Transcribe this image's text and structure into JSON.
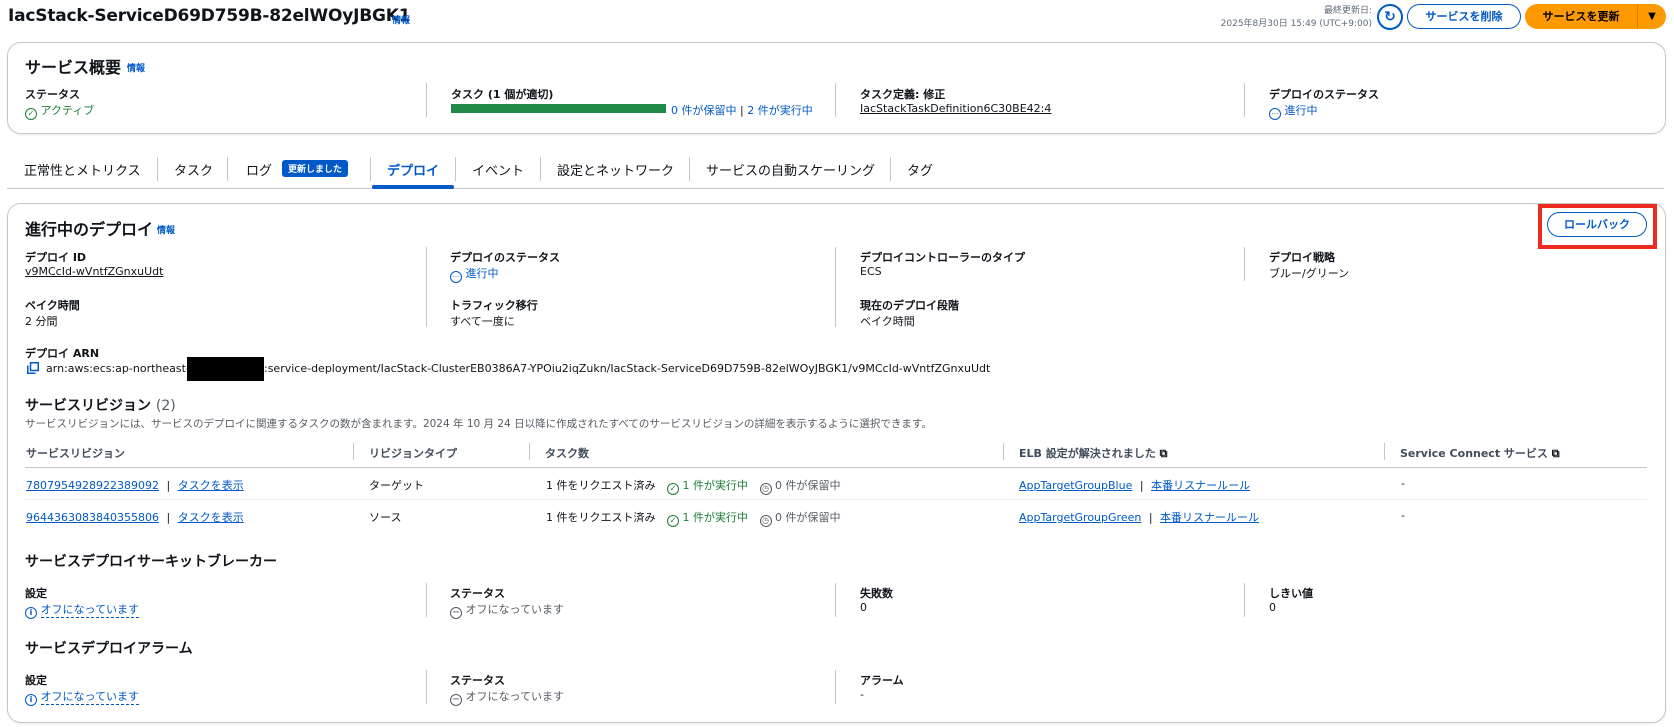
{
  "header": {
    "title": "IacStack-ServiceD69D759B-82elWOyJBGK1",
    "info": "情報",
    "last_updated_label": "最終更新日:",
    "last_updated_value": "2025年8月30日 15:49 (UTC+9:00)",
    "delete_label": "サービスを削除",
    "update_label": "サービスを更新"
  },
  "overview": {
    "heading": "サービス概要",
    "info": "情報",
    "status_label": "ステータス",
    "status_value": "アクティブ",
    "tasks_label": "タスク (1 個が適切)",
    "tasks_progress": 1.0,
    "tasks_pending": "0 件が保留中",
    "tasks_sep": "|",
    "tasks_running": "2 件が実行中",
    "taskdef_label": "タスク定義: 修正",
    "taskdef_value": "IacStackTaskDefinition6C30BE42:4",
    "deploy_status_label": "デプロイのステータス",
    "deploy_status_value": "進行中"
  },
  "tabs": [
    {
      "label": "正常性とメトリクス"
    },
    {
      "label": "タスク"
    },
    {
      "label": "ログ",
      "badge": "更新しました"
    },
    {
      "label": "デプロイ",
      "active": true
    },
    {
      "label": "イベント"
    },
    {
      "label": "設定とネットワーク"
    },
    {
      "label": "サービスの自動スケーリング"
    },
    {
      "label": "タグ"
    }
  ],
  "deployment": {
    "heading": "進行中のデプロイ",
    "info": "情報",
    "rollback_label": "ロールバック",
    "id_label": "デプロイ ID",
    "id_value": "v9MCcId-wVntfZGnxuUdt",
    "status_label": "デプロイのステータス",
    "status_value": "進行中",
    "controller_label": "デプロイコントローラーのタイプ",
    "controller_value": "ECS",
    "strategy_label": "デプロイ戦略",
    "strategy_value": "ブルー/グリーン",
    "bake_label": "ベイク時間",
    "bake_value": "2 分間",
    "traffic_label": "トラフィック移行",
    "traffic_value": "すべて一度に",
    "phase_label": "現在のデプロイ段階",
    "phase_value": "ベイク時間",
    "arn_label": "デプロイ ARN",
    "arn_prefix": "arn:aws:ecs:ap-northeast-1:",
    "arn_suffix": ":service-deployment/IacStack-ClusterEB0386A7-YPOiu2iqZukn/IacStack-ServiceD69D759B-82elWOyJBGK1/v9MCcId-wVntfZGnxuUdt"
  },
  "revisions": {
    "heading": "サービスリビジョン",
    "count": "(2)",
    "description": "サービスリビジョンには、サービスのデプロイに関連するタスクの数が含まれます。2024 年 10 月 24 日以降に作成されたすべてのサービスリビジョンの詳細を表示するように選択できます。",
    "columns": [
      "サービスリビジョン",
      "リビジョンタイプ",
      "タスク数",
      "ELB 設定が解決されました",
      "Service Connect サービス"
    ],
    "rows": [
      {
        "id": "7807954928922389092",
        "view": "タスクを表示",
        "type": "ターゲット",
        "requested": "1 件をリクエスト済み",
        "running": "1 件が実行中",
        "pending": "0 件が保留中",
        "tg": "AppTargetGroupBlue",
        "rule": "本番リスナールール",
        "sc": "-"
      },
      {
        "id": "9644363083840355806",
        "view": "タスクを表示",
        "type": "ソース",
        "requested": "1 件をリクエスト済み",
        "running": "1 件が実行中",
        "pending": "0 件が保留中",
        "tg": "AppTargetGroupGreen",
        "rule": "本番リスナールール",
        "sc": "-"
      }
    ]
  },
  "circuit_breaker": {
    "heading": "サービスデプロイサーキットブレーカー",
    "setting_label": "設定",
    "setting_value": "オフになっています",
    "status_label": "ステータス",
    "status_value": "オフになっています",
    "failures_label": "失敗数",
    "failures_value": "0",
    "threshold_label": "しきい値",
    "threshold_value": "0"
  },
  "alarms": {
    "heading": "サービスデプロイアラーム",
    "setting_label": "設定",
    "setting_value": "オフになっています",
    "status_label": "ステータス",
    "status_value": "オフになっています",
    "alarm_label": "アラーム",
    "alarm_value": "-"
  },
  "colors": {
    "primary": "#0059c7",
    "update_button": "#ff9900",
    "success": "#1c7d36",
    "highlight": "#ee2b1f"
  }
}
